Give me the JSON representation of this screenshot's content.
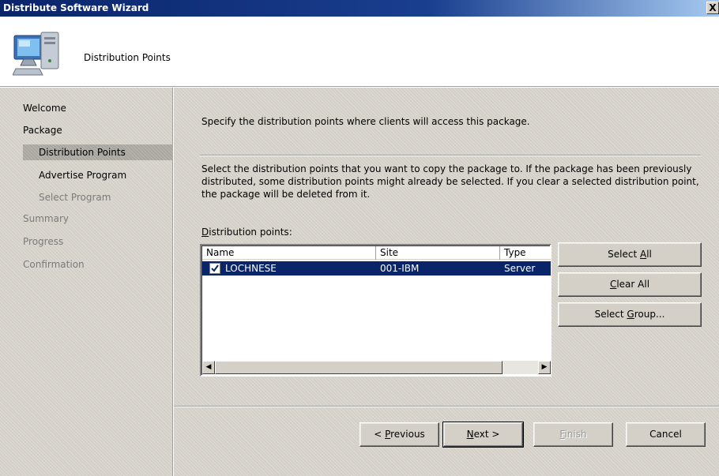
{
  "window": {
    "title": "Distribute Software Wizard",
    "close_glyph": "X"
  },
  "header": {
    "title": "Distribution Points",
    "icon": "computer-icon"
  },
  "nav": {
    "items": [
      {
        "label": "Welcome",
        "state": "done"
      },
      {
        "label": "Package",
        "state": "done"
      },
      {
        "label": "Distribution Points",
        "state": "selected"
      },
      {
        "label": "Advertise Program",
        "state": "active"
      },
      {
        "label": "Select Program",
        "state": "dim"
      },
      {
        "label": "Summary",
        "state": "dim"
      },
      {
        "label": "Progress",
        "state": "dim"
      },
      {
        "label": "Confirmation",
        "state": "dim"
      }
    ]
  },
  "main": {
    "instruction": "Specify the distribution points where clients will access this package.",
    "description": "Select the distribution points that you want to copy the package to. If the package has been previously distributed, some distribution points might already be selected. If you clear a selected distribution point, the package will be deleted from it.",
    "list_label_accel": "D",
    "list_label_rest": "istribution points:",
    "columns": {
      "name": "Name",
      "site": "Site",
      "type": "Type"
    },
    "rows": [
      {
        "name": "LOCHNESE",
        "site": "001-IBM",
        "type": "Server",
        "checked": true,
        "selected": true
      }
    ],
    "side_buttons": {
      "select_all_pre": "Select ",
      "select_all_accel": "A",
      "select_all_post": "ll",
      "clear_all_accel": "C",
      "clear_all_post": "lear All",
      "select_group_pre": "Select ",
      "select_group_accel": "G",
      "select_group_post": "roup..."
    }
  },
  "footer": {
    "previous_pre": "< ",
    "previous_accel": "P",
    "previous_post": "revious",
    "next_accel": "N",
    "next_post": "ext >",
    "finish_accel": "F",
    "finish_post": "inish",
    "cancel": "Cancel"
  }
}
